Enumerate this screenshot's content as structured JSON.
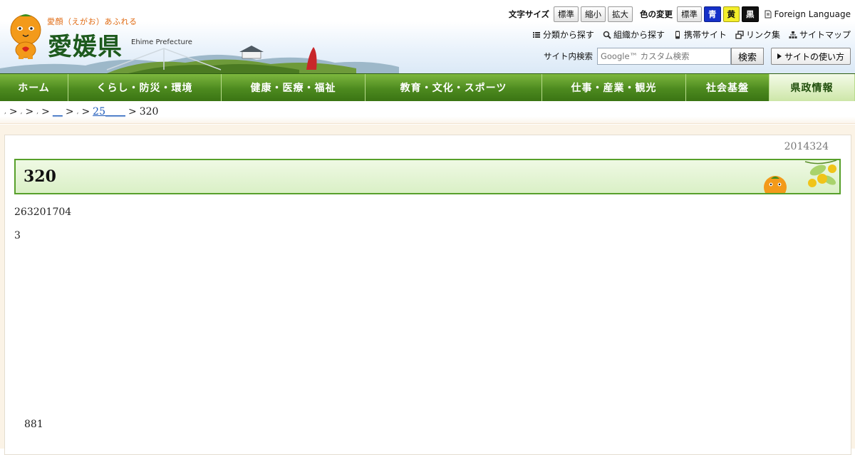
{
  "header": {
    "tagline": "愛顔（えがお）あふれる",
    "pref_name": "愛媛県",
    "pref_name_en": "Ehime Prefecture"
  },
  "utility": {
    "font_size_label": "文字サイズ",
    "font_size_buttons": [
      "標準",
      "縮小",
      "拡大"
    ],
    "color_label": "色の変更",
    "color_buttons": [
      "標準",
      "青",
      "黄",
      "黒"
    ],
    "foreign_language": "Foreign Language",
    "links": [
      "分類から探す",
      "組織から探す",
      "携帯サイト",
      "リンク集",
      "サイトマップ"
    ],
    "search_label": "サイト内検索",
    "search_placeholder": "Google™ カスタム検索",
    "search_button": "検索",
    "howto_button": "サイトの使い方"
  },
  "nav": {
    "items": [
      "ホーム",
      "くらし・防災・環境",
      "健康・医療・福祉",
      "教育・文化・スポーツ",
      "仕事・産業・観光",
      "社会基盤",
      "県政情報"
    ],
    "active_index": 6
  },
  "breadcrumb": {
    "link_25": "25____",
    "underscore_link": "__",
    "current": "320"
  },
  "page": {
    "date": "2014324",
    "title": "320",
    "line1": "263201704",
    "line2": "3",
    "footer": "881"
  },
  "colors": {
    "nav_green": "#4d8a1f",
    "title_border": "#58a02b",
    "link_blue": "#1b58b8",
    "accent_orange": "#e06a12"
  }
}
